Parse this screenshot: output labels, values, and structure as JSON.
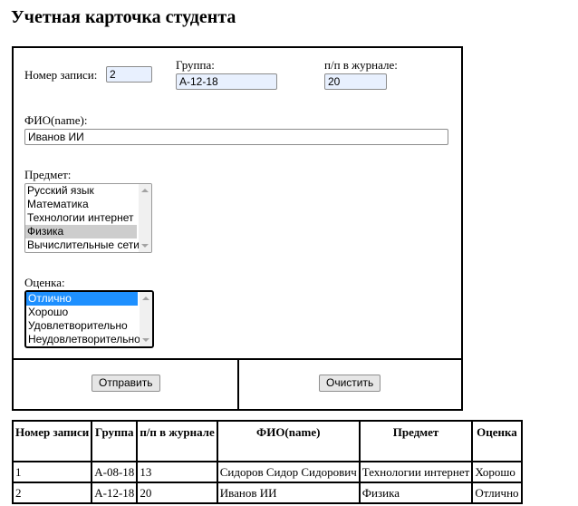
{
  "title": "Учетная карточка студента",
  "form": {
    "record_label": "Номер записи:",
    "record_value": "2",
    "group_label": "Группа:",
    "group_value": "А-12-18",
    "journal_label": "п/п в журнале:",
    "journal_value": "20",
    "name_label": "ФИО(name):",
    "name_value": "Иванов ИИ",
    "subject_label": "Предмет:",
    "subjects": [
      "Русский язык",
      "Математика",
      "Технологии интернет",
      "Физика",
      "Вычислительные сети"
    ],
    "subject_selected": "Физика",
    "grade_label": "Оценка:",
    "grades": [
      "Отлично",
      "Хорошо",
      "Удовлетворительно",
      "Неудовлетворительно"
    ],
    "grade_selected": "Отлично",
    "submit_label": "Отправить",
    "clear_label": "Очистить"
  },
  "table": {
    "headers": [
      "Номер записи",
      "Группа",
      "п/п в журнале",
      "ФИО(name)",
      "Предмет",
      "Оценка"
    ],
    "rows": [
      [
        "1",
        "А-08-18",
        "13",
        "Сидоров Сидор Сидорович",
        "Технологии интернет",
        "Хорошо"
      ],
      [
        "2",
        "А-12-18",
        "20",
        "Иванов ИИ",
        "Физика",
        "Отлично"
      ]
    ]
  }
}
